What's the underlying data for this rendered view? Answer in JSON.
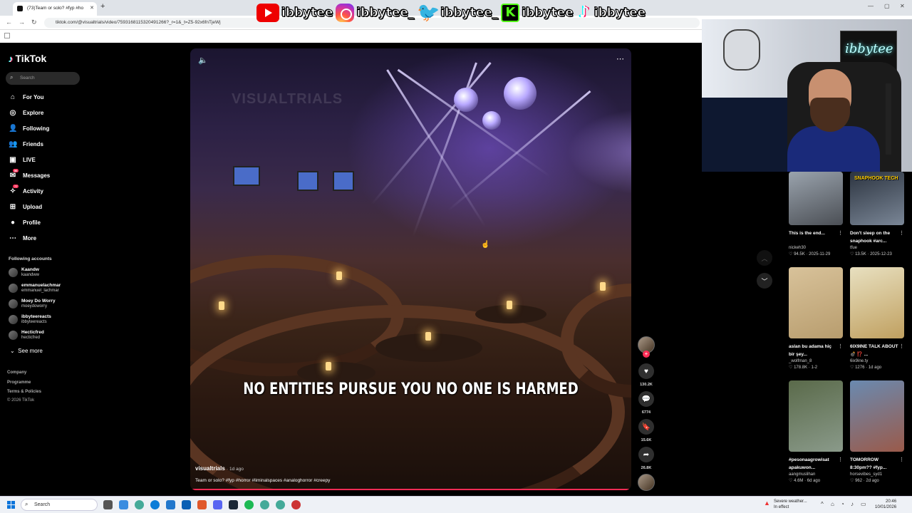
{
  "browser": {
    "tab_title": "(73)Team or solo? #fyp #ho",
    "url": "tiktok.com/@visualtrials/video/7593168115320491266?_r=1&_t=Z5-92x6fnTjeWj"
  },
  "stream_banner": {
    "handles": [
      "ibbytee",
      "ibbytee_",
      "ibbytee_",
      "ibbytee",
      "ibbytee"
    ]
  },
  "sidebar": {
    "logo": "TikTok",
    "search_placeholder": "Search",
    "nav": [
      {
        "label": "For You",
        "icon": "home-icon"
      },
      {
        "label": "Explore",
        "icon": "compass-icon"
      },
      {
        "label": "Following",
        "icon": "following-icon"
      },
      {
        "label": "Friends",
        "icon": "friends-icon"
      },
      {
        "label": "LIVE",
        "icon": "live-icon"
      },
      {
        "label": "Messages",
        "icon": "messages-icon",
        "badge": "56"
      },
      {
        "label": "Activity",
        "icon": "activity-icon",
        "badge": "77"
      },
      {
        "label": "Upload",
        "icon": "upload-icon"
      },
      {
        "label": "Profile",
        "icon": "profile-icon"
      },
      {
        "label": "More",
        "icon": "more-icon"
      }
    ],
    "following_title": "Following accounts",
    "accounts": [
      {
        "name": "Kaandw",
        "handle": "kaandww"
      },
      {
        "name": "emmanuelachmar",
        "handle": "emmanuel_lachmar"
      },
      {
        "name": "Moey Do Worry",
        "handle": "moeydoworry"
      },
      {
        "name": "ibbyteereacts",
        "handle": "ibbyteereacts"
      },
      {
        "name": "Hecticfred",
        "handle": "hecticfred"
      }
    ],
    "see_more": "See more",
    "footer": [
      "Company",
      "Programme",
      "Terms & Policies",
      "© 2026 TikTok"
    ]
  },
  "video": {
    "watermark": "VISUALTRIALS",
    "caption": "NO ENTITIES PURSUE YOU NO ONE IS HARMED",
    "author": "visualtrials",
    "age": "· 1d ago",
    "description": "Team or solo? #fyp #horror #liminalspaces #analoghorror #creepy"
  },
  "actions": {
    "likes": "130.2K",
    "comments": "6774",
    "saves": "15.6K",
    "shares": "26.8K"
  },
  "webcam": {
    "neon_sign": "ibbytee"
  },
  "recommended": [
    {
      "title": "This is the end...",
      "author": "nickeh30",
      "likes": "94.5K",
      "date": "2025-11-29",
      "color1": "#9aa3ad",
      "color2": "#4b4f55",
      "label": ""
    },
    {
      "title": "Don't sleep on the snaphook #arc...",
      "author": "tfue",
      "likes": "13.5K",
      "date": "2025-12-23",
      "color1": "#2c3440",
      "color2": "#7a8696",
      "label": "SNAPHOOK TECH"
    },
    {
      "title": "aslan bu adama hiç bir şey...",
      "author": "_wolfman_8",
      "likes": "178.8K",
      "date": "1-2",
      "color1": "#d8c29a",
      "color2": "#b89d6e",
      "label": ""
    },
    {
      "title": "6IX9INE TALK ABOUT 💣 ⁉️ ...",
      "author": "6ix9ine.ty",
      "likes": "1276",
      "date": "1d ago",
      "color1": "#e8e0c0",
      "color2": "#c0a060",
      "label": ""
    },
    {
      "title": "#pesonaagrowisat apakuwon...",
      "author": "aangmuslihan",
      "likes": "4.6M",
      "date": "6d ago",
      "color1": "#5a6a4a",
      "color2": "#8a9a8a",
      "label": ""
    },
    {
      "title": "TOMORROW 8:30pm?? #fyp...",
      "author": "horsevibes_syd1",
      "likes": "962",
      "date": "2d ago",
      "color1": "#6a8ab0",
      "color2": "#9a5a4a",
      "label": ""
    }
  ],
  "taskbar": {
    "search": "Search",
    "weather_title": "Severe weather...",
    "weather_sub": "In effect",
    "time": "20:46",
    "date": "10/01/2026"
  }
}
